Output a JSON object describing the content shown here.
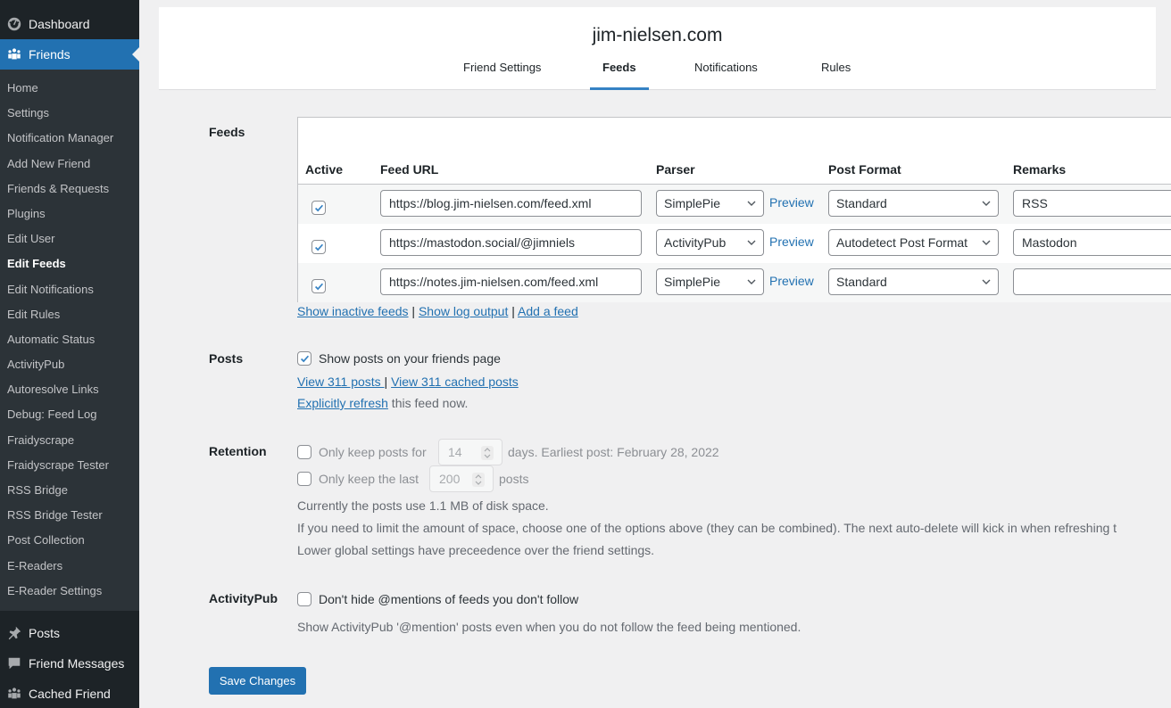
{
  "sidebar": {
    "dashboard": "Dashboard",
    "friends": "Friends",
    "submenu": [
      {
        "label": "Home"
      },
      {
        "label": "Settings"
      },
      {
        "label": "Notification Manager"
      },
      {
        "label": "Add New Friend"
      },
      {
        "label": "Friends & Requests"
      },
      {
        "label": "Plugins"
      },
      {
        "label": "Edit User"
      },
      {
        "label": "Edit Feeds",
        "active": true
      },
      {
        "label": "Edit Notifications"
      },
      {
        "label": "Edit Rules"
      },
      {
        "label": "Automatic Status"
      },
      {
        "label": "ActivityPub"
      },
      {
        "label": "Autoresolve Links"
      },
      {
        "label": "Debug: Feed Log"
      },
      {
        "label": "Fraidyscrape"
      },
      {
        "label": "Fraidyscrape Tester"
      },
      {
        "label": "RSS Bridge"
      },
      {
        "label": "RSS Bridge Tester"
      },
      {
        "label": "Post Collection"
      },
      {
        "label": "E-Readers"
      },
      {
        "label": "E-Reader Settings"
      }
    ],
    "posts": "Posts",
    "friend_messages": "Friend Messages",
    "cached_friend": "Cached Friend"
  },
  "header": {
    "site_title": "jim-nielsen.com",
    "tabs": [
      {
        "label": "Friend Settings"
      },
      {
        "label": "Feeds",
        "active": true
      },
      {
        "label": "Notifications"
      },
      {
        "label": "Rules"
      }
    ]
  },
  "feeds": {
    "label": "Feeds",
    "columns": {
      "active": "Active",
      "url": "Feed URL",
      "parser": "Parser",
      "post_format": "Post Format",
      "remarks": "Remarks"
    },
    "rows": [
      {
        "active": true,
        "url": "https://blog.jim-nielsen.com/feed.xml",
        "parser": "SimplePie",
        "preview": "Preview",
        "post_format": "Standard",
        "remarks": "RSS"
      },
      {
        "active": true,
        "url": "https://mastodon.social/@jimniels",
        "parser": "ActivityPub",
        "preview": "Preview",
        "post_format": "Autodetect Post Format",
        "remarks": "Mastodon"
      },
      {
        "active": true,
        "url": "https://notes.jim-nielsen.com/feed.xml",
        "parser": "SimplePie",
        "preview": "Preview",
        "post_format": "Standard",
        "remarks": ""
      }
    ],
    "links": {
      "show_inactive": "Show inactive feeds",
      "show_log": "Show log output",
      "add_feed": "Add a feed",
      "sep": "|"
    }
  },
  "posts": {
    "label": "Posts",
    "show_on_friends_page": "Show posts on your friends page",
    "show_checked": true,
    "view_posts": "View 311 posts ",
    "view_cached": "View 311 cached posts",
    "sep": "|",
    "refresh_link": "Explicitly refresh",
    "refresh_suffix": " this feed now."
  },
  "retention": {
    "label": "Retention",
    "keep_days_prefix": "Only keep posts for",
    "keep_days_value": "14",
    "keep_days_suffix": "days. Earliest post: February 28, 2022",
    "keep_last_prefix": "Only keep the last",
    "keep_last_value": "200",
    "keep_last_suffix": "posts",
    "disk_usage": "Currently the posts use 1.1 MB of disk space.",
    "limit_note": "If you need to limit the amount of space, choose one of the options above (they can be combined). The next auto-delete will kick in when refreshing t",
    "global_note": "Lower global settings have preceedence over the friend settings."
  },
  "activitypub": {
    "label": "ActivityPub",
    "option": "Don't hide @mentions of feeds you don't follow",
    "description": "Show ActivityPub '@mention' posts even when you do not follow the feed being mentioned."
  },
  "save_button": "Save Changes"
}
